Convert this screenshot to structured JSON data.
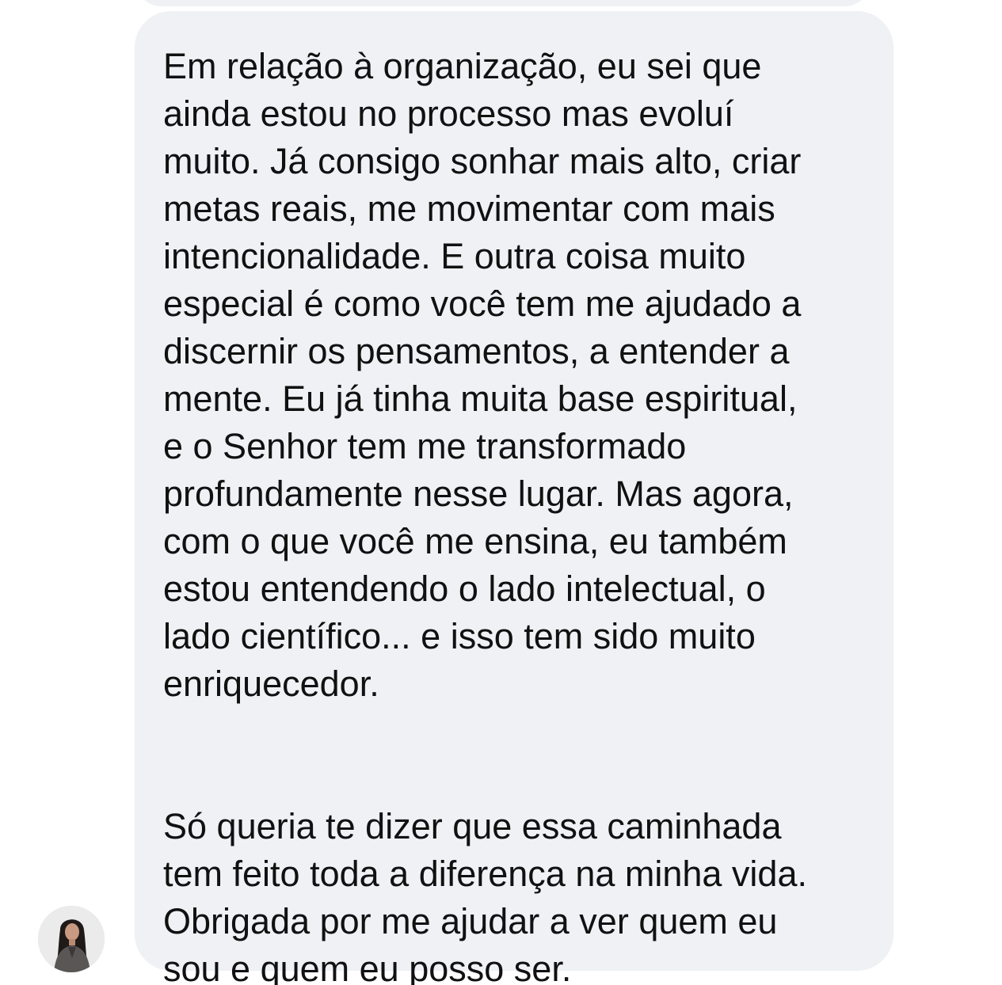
{
  "conversation": {
    "previous_message": {
      "visible": true
    },
    "message": {
      "text": "Em relação à organização, eu sei que\nainda estou no processo mas evoluí\nmuito. Já consigo sonhar mais alto, criar\nmetas reais, me movimentar com mais\nintencionalidade. E outra coisa muito\nespecial é como você tem me ajudado a\ndiscernir os pensamentos, a entender a\nmente. Eu já tinha muita base espiritual,\ne o Senhor tem me transformado\nprofundamente nesse lugar. Mas agora,\ncom o que você me ensina, eu também\nestou entendendo o lado intelectual, o\nlado científico... e isso tem sido muito\nenriquecedor.\n\n\nSó queria te dizer que essa caminhada\ntem feito toda a diferença na minha vida.\nObrigada por me ajudar a ver quem eu\nsou e quem eu posso ser.",
      "bubble_color": "#eff1f4",
      "text_color": "#111111"
    },
    "sender": {
      "avatar_icon": "user-avatar-photo"
    }
  }
}
